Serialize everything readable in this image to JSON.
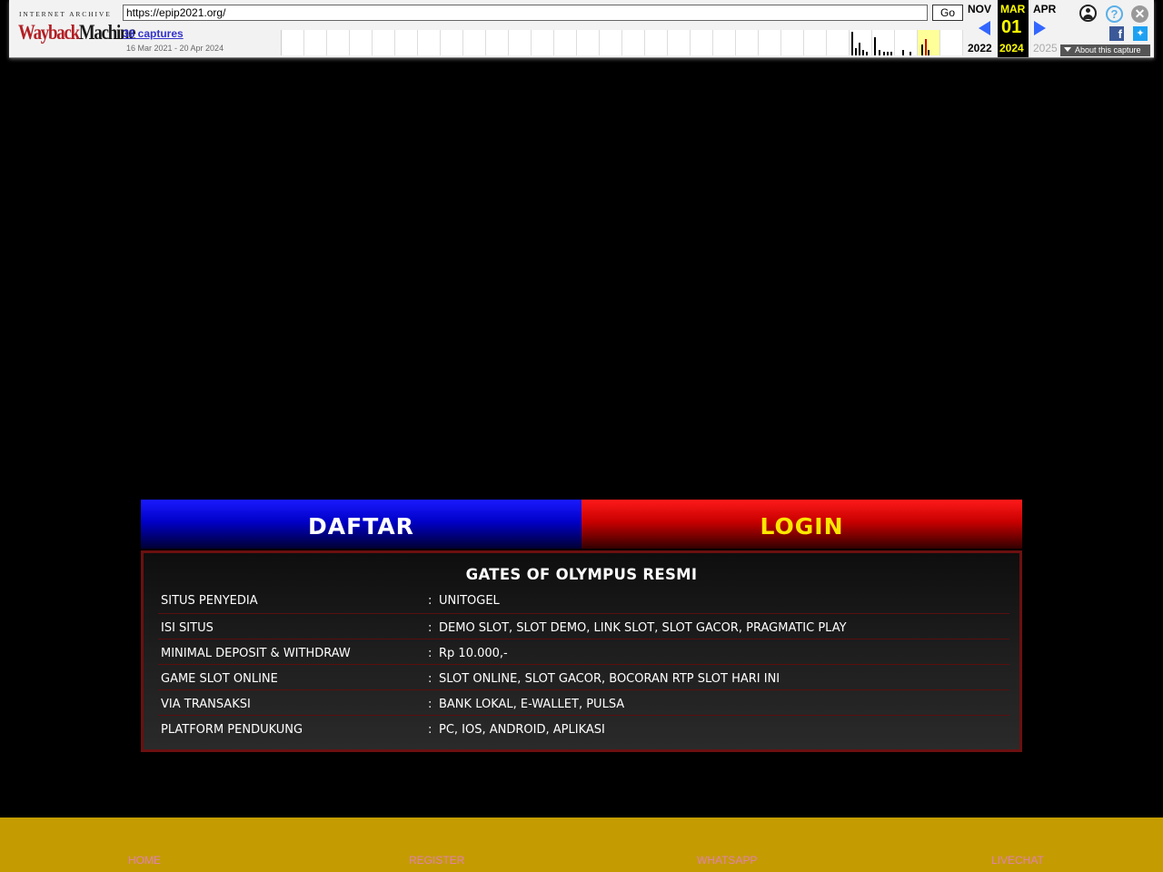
{
  "wayback": {
    "logo_top": "INTERNET ARCHIVE",
    "logo_wayback": "WaybackMachine",
    "logo_wb1": "Wayback",
    "logo_wb2": "Machine",
    "url": "https://epip2021.org/",
    "go_label": "Go",
    "captures": "38 captures",
    "range": "16 Mar 2021 - 20 Apr 2024",
    "prev_month": "NOV",
    "prev_year": "2022",
    "cur_month": "MAR",
    "cur_day": "01",
    "cur_year": "2024",
    "next_month": "APR",
    "next_year": "2025",
    "about_label": "About this capture",
    "icons": [
      "user-icon",
      "help-icon",
      "close-icon",
      "facebook-icon",
      "twitter-icon"
    ],
    "colors": {
      "current_bg": "#000000",
      "current_text": "#ffff00",
      "arrow": "#3366ff"
    }
  },
  "buttons": {
    "daftar": "DAFTAR",
    "login": "LOGIN"
  },
  "info": {
    "title": "GATES OF OLYMPUS RESMI",
    "rows": [
      {
        "key": "SITUS PENYEDIA",
        "sep": ":",
        "value": "UNITOGEL"
      },
      {
        "key": "ISI SITUS",
        "sep": ":",
        "value": "DEMO SLOT, SLOT DEMO, LINK SLOT, SLOT GACOR, PRAGMATIC PLAY"
      },
      {
        "key": "MINIMAL DEPOSIT & WITHDRAW",
        "sep": ":",
        "value": "Rp 10.000,-"
      },
      {
        "key": "GAME SLOT ONLINE",
        "sep": ":",
        "value": "SLOT ONLINE, SLOT GACOR, BOCORAN RTP SLOT HARI INI"
      },
      {
        "key": "VIA TRANSAKSI",
        "sep": ":",
        "value": "BANK LOKAL, E-WALLET, PULSA"
      },
      {
        "key": "PLATFORM PENDUKUNG",
        "sep": ":",
        "value": "PC, IOS, ANDROID, APLIKASI"
      }
    ]
  },
  "footer": {
    "home": "HOME",
    "register": "REGISTER",
    "whatsapp": "WHATSAPP",
    "livechat": "LIVECHAT",
    "bg_color": "#c49b00"
  }
}
